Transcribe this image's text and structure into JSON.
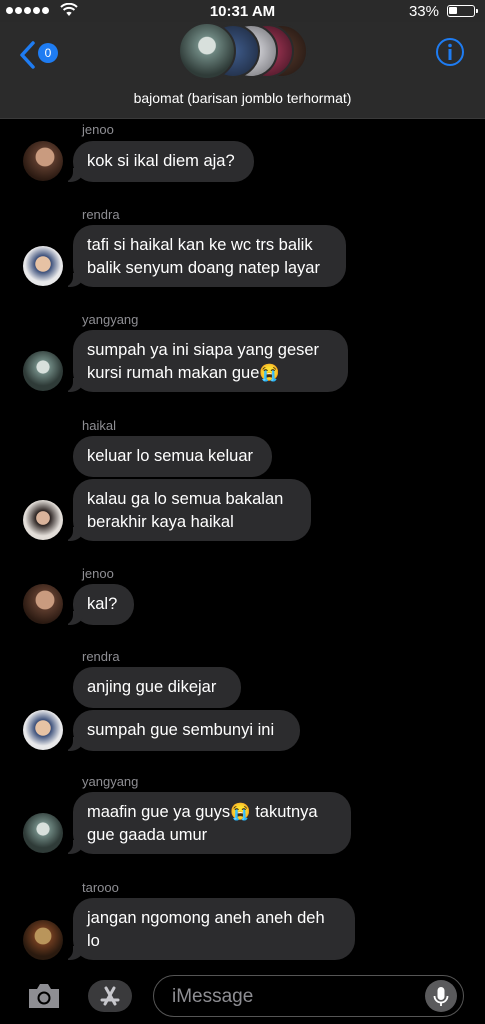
{
  "status": {
    "time": "10:31 AM",
    "battery": "33%",
    "battery_level": 0.33
  },
  "header": {
    "back_badge": "0",
    "group_name": "bajomat (barisan jomblo terhormat)"
  },
  "messages": [
    {
      "sender": "jenoo",
      "avatar": "jenoo",
      "texts": [
        "kok si ikal diem aja?"
      ]
    },
    {
      "sender": "rendra",
      "avatar": "rendra",
      "texts": [
        "tafi si haikal kan ke wc trs balik balik senyum doang natep layar"
      ]
    },
    {
      "sender": "yangyang",
      "avatar": "yangyang",
      "texts": [
        "sumpah ya ini siapa yang geser kursi rumah makan gue😭"
      ]
    },
    {
      "sender": "haikal",
      "avatar": "haikal",
      "texts": [
        "keluar lo semua keluar",
        "kalau ga lo semua bakalan berakhir kaya haikal"
      ]
    },
    {
      "sender": "jenoo",
      "avatar": "jenoo",
      "texts": [
        "kal?"
      ]
    },
    {
      "sender": "rendra",
      "avatar": "rendra",
      "texts": [
        "anjing gue dikejar",
        "sumpah gue sembunyi ini"
      ]
    },
    {
      "sender": "yangyang",
      "avatar": "yangyang",
      "texts": [
        "maafin gue ya guys😭 takutnya gue gaada umur"
      ]
    },
    {
      "sender": "tarooo",
      "avatar": "tarooo",
      "texts": [
        "jangan ngomong aneh aneh deh lo"
      ]
    }
  ],
  "input": {
    "placeholder": "iMessage"
  },
  "icons": {
    "back": "chevron-left-icon",
    "info": "info-icon",
    "camera": "camera-icon",
    "apps": "app-store-icon",
    "mic": "microphone-icon"
  },
  "colors": {
    "accent": "#1e7cf2",
    "bubble": "#2c2c2e",
    "background": "#000000"
  }
}
